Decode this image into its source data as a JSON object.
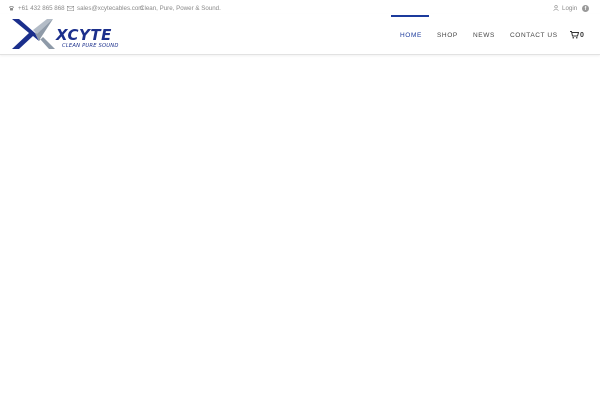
{
  "topbar": {
    "phone": "+61 432 865 868",
    "email": "sales@xcytecables.com",
    "tagline": "Clean, Pure, Power & Sound.",
    "login": "Login",
    "social_icon": "facebook-icon"
  },
  "logo": {
    "wordmark": "XCYTE",
    "subtitle": "CLEAN PURE SOUND",
    "colors": {
      "blue": "#1b2f8c",
      "gray": "#8e9aa8"
    }
  },
  "nav": {
    "items": [
      "HOME",
      "SHOP",
      "NEWS",
      "CONTACT US"
    ],
    "active": "HOME",
    "active_color": "#1b3a9c"
  },
  "cart": {
    "count": "0",
    "icon": "cart-icon"
  }
}
